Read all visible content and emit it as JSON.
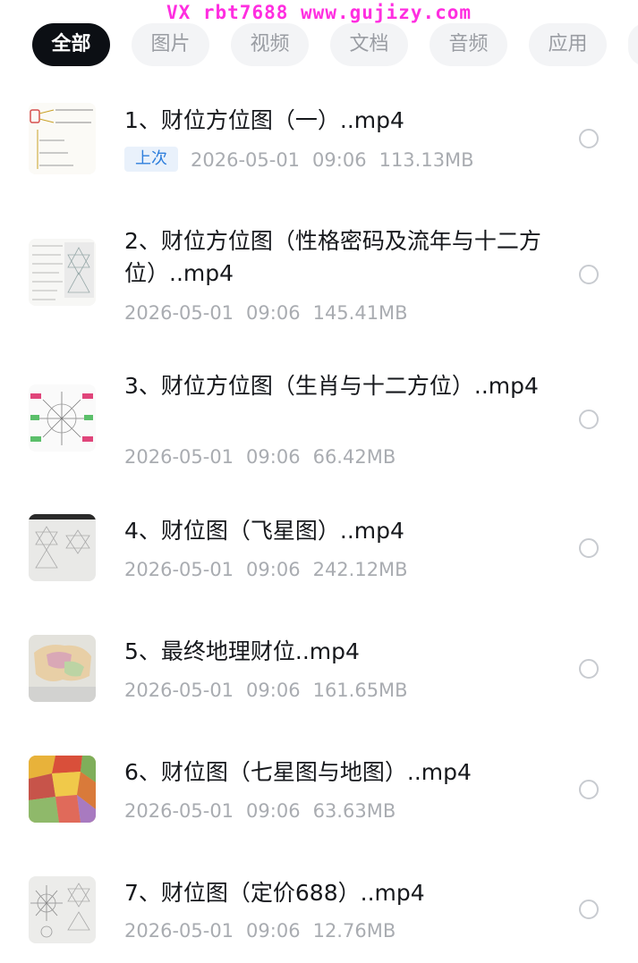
{
  "watermark": "VX rbt7688 www.gujizy.com",
  "tabs": [
    {
      "label": "全部",
      "active": true
    },
    {
      "label": "图片",
      "active": false
    },
    {
      "label": "视频",
      "active": false
    },
    {
      "label": "文档",
      "active": false
    },
    {
      "label": "音频",
      "active": false
    },
    {
      "label": "应用",
      "active": false
    }
  ],
  "files": [
    {
      "title": "1、财位方位图（一）..mp4",
      "badge": "上次",
      "date": "2026-05-01",
      "time": "09:06",
      "size": "113.13MB",
      "thumb_icon": "mindmap-thumbnail"
    },
    {
      "title": "2、财位方位图（性格密码及流年与十二方位）..mp4",
      "badge": "",
      "date": "2026-05-01",
      "time": "09:06",
      "size": "145.41MB",
      "thumb_icon": "document-thumbnail"
    },
    {
      "title": "3、财位方位图（生肖与十二方位）..mp4",
      "badge": "",
      "date": "2026-05-01",
      "time": "09:06",
      "size": "66.42MB",
      "thumb_icon": "diagram-thumbnail"
    },
    {
      "title": "4、财位图（飞星图）..mp4",
      "badge": "",
      "date": "2026-05-01",
      "time": "09:06",
      "size": "242.12MB",
      "thumb_icon": "flying-star-thumbnail"
    },
    {
      "title": "5、最终地理财位..mp4",
      "badge": "",
      "date": "2026-05-01",
      "time": "09:06",
      "size": "161.65MB",
      "thumb_icon": "map-thumbnail"
    },
    {
      "title": "6、财位图（七星图与地图）..mp4",
      "badge": "",
      "date": "2026-05-01",
      "time": "09:06",
      "size": "63.63MB",
      "thumb_icon": "colored-map-thumbnail"
    },
    {
      "title": "7、财位图（定价688）..mp4",
      "badge": "",
      "date": "2026-05-01",
      "time": "09:06",
      "size": "12.76MB",
      "thumb_icon": "sketch-thumbnail"
    }
  ],
  "colors": {
    "accent": "#2f7fdc",
    "active_tab": "#0c0f14",
    "watermark": "#ff2ee0"
  }
}
